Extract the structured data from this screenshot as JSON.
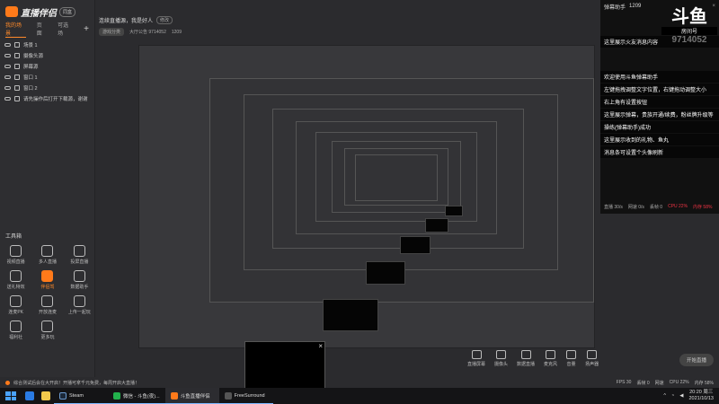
{
  "app": {
    "brand": "直播伴侣",
    "version_badge": "同盒",
    "tabs": [
      "我的场景",
      "页面",
      "可选场"
    ],
    "add": "+"
  },
  "layers": [
    "场景 1",
    "摄像头源",
    "屏幕源",
    "窗口 1",
    "窗口 2",
    "请先操作后打开下载源，谢谢"
  ],
  "toolbox": {
    "title": "工具箱",
    "tools": [
      {
        "icon": "camera-icon",
        "label": "视频直播"
      },
      {
        "icon": "multi-user-icon",
        "label": "多人直播"
      },
      {
        "icon": "tv-icon",
        "label": "投屏直播"
      },
      {
        "icon": "gift-icon",
        "label": "送礼特效"
      },
      {
        "icon": "companion-icon",
        "label": "伴侣驾",
        "highlight": true
      },
      {
        "icon": "record-icon",
        "label": "数据助手"
      },
      {
        "icon": "pk-icon",
        "label": "连麦PK"
      },
      {
        "icon": "mic-icon",
        "label": "开放连麦"
      },
      {
        "icon": "share-icon",
        "label": "上传一起玩"
      },
      {
        "icon": "bag-icon",
        "label": "福利社"
      },
      {
        "icon": "more-icon",
        "label": "更多玩"
      }
    ]
  },
  "room": {
    "title": "连续直播源，我是好人",
    "edit_label": "修改",
    "category": "游戏分类",
    "room_id": "大厅公告 9714052",
    "viewers": "1209"
  },
  "right_panel": {
    "label": "弹幕助手",
    "viewer_count": "1209",
    "close": "×",
    "douyu_logo": "斗鱼",
    "room_label": "房间号",
    "room_number": "9714052",
    "chat": [
      "这里展示火友消息内容",
      "欢迎使用斗鱼弹幕助手",
      "左键拖拽调整文字位置，右键拖动调整大小",
      "右上角有设置按钮",
      "这里展示弹幕，贵族开通/续费，粉丝牌升级等",
      "操练(弹幕助手)成功",
      "这里展示收到的礼物、鱼丸",
      "消息条可设置个头像刷新"
    ],
    "stats": [
      "直播 30/s",
      "网速 0/s",
      "丢帧 0",
      "CPU 22%",
      "内存 58%"
    ]
  },
  "controls": {
    "items": [
      {
        "icon": "screen-icon",
        "label": "直播屏幕"
      },
      {
        "icon": "camera-icon",
        "label": "摄像头"
      },
      {
        "icon": "record-icon",
        "label": "数据直播"
      },
      {
        "icon": "mic-icon",
        "label": "麦克风"
      },
      {
        "icon": "speaker-icon",
        "label": "音量"
      },
      {
        "icon": "speaker-out-icon",
        "label": "扬声器"
      }
    ],
    "start_button": "开始直播"
  },
  "statusbar": {
    "message": "综合测试后会在大开启！开播可拿千元免费，每周开启大直播！",
    "right": [
      "FPS 30",
      "丢帧 0",
      "网速",
      "CPU 22%",
      "内存 58%"
    ]
  },
  "taskbar": {
    "apps": [
      {
        "label": "Steam",
        "color": "#1b2838"
      },
      {
        "label": "微信 - 斗鱼(夜)...",
        "color": "#22b14c"
      },
      {
        "label": "斗鱼直播伴侣",
        "color": "#ff7a1a"
      },
      {
        "label": "FreeSurround",
        "color": "#444444"
      }
    ],
    "time": "20:20 周三",
    "date": "2021/10/13"
  }
}
